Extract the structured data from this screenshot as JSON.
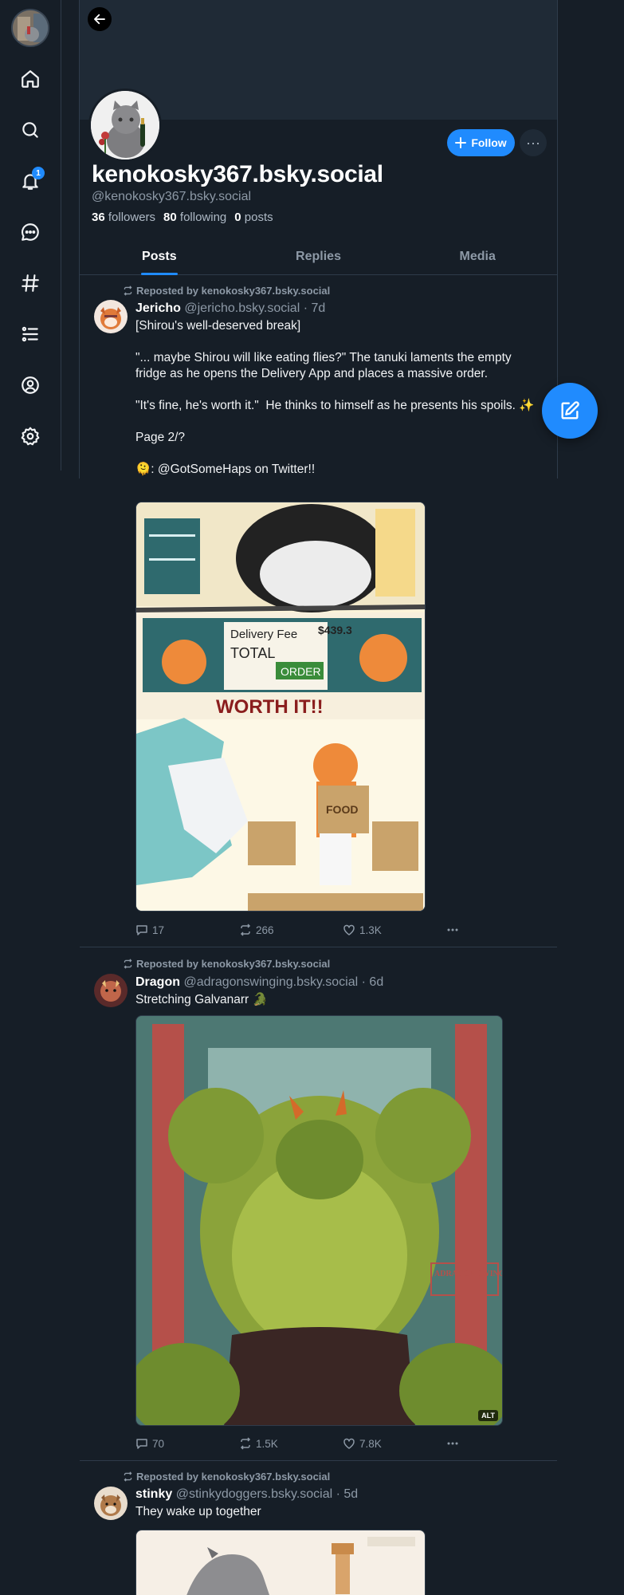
{
  "nav": {
    "notification_count": "1",
    "items": [
      "home-icon",
      "search-icon",
      "bell-icon",
      "chat-icon",
      "hashtag-icon",
      "list-icon",
      "profile-icon",
      "gear-icon"
    ]
  },
  "profile": {
    "display_name": "kenokosky367.bsky.social",
    "handle": "@kenokosky367.bsky.social",
    "followers_count": "36",
    "followers_label": "followers",
    "following_count": "80",
    "following_label": "following",
    "posts_count": "0",
    "posts_label": "posts",
    "follow_label": "Follow",
    "more_label": "···"
  },
  "tabs": [
    "Posts",
    "Replies",
    "Media"
  ],
  "posts": [
    {
      "repost_label": "Reposted by kenokosky367.bsky.social",
      "author": "Jericho",
      "handle": "@jericho.bsky.social",
      "time": "· 7d",
      "text": "[Shirou's well-deserved break]\n\n\"... maybe Shirou will like eating flies?\" The tanuki laments the empty fridge as he opens the Delivery App and places a massive order.\n\n\"It's fine, he's worth it.\"  He thinks to himself as he presents his spoils. ✨\n\nPage 2/?\n\n🫠: @GotSomeHaps on Twitter!!",
      "image_text_1": "Delivery Fee",
      "image_text_2": "TOTAL",
      "image_text_3": "$439.3",
      "image_text_4": "ORDER",
      "image_text_5": "WORTH IT!!",
      "image_text_6": "FOOD",
      "replies": "17",
      "reposts": "266",
      "likes": "1.3K"
    },
    {
      "repost_label": "Reposted by kenokosky367.bsky.social",
      "author": "Dragon",
      "handle": "@adragonswinging.bsky.social",
      "time": "· 6d",
      "text": "Stretching Galvanarr 🐊",
      "image_watermark": "ADRAGON SWINGING 2025",
      "alt": "ALT",
      "replies": "70",
      "reposts": "1.5K",
      "likes": "7.8K"
    },
    {
      "repost_label": "Reposted by kenokosky367.bsky.social",
      "author": "stinky",
      "handle": "@stinkydoggers.bsky.social",
      "time": "· 5d",
      "text": "They wake up together"
    }
  ],
  "colors": {
    "accent": "#208bfe",
    "background": "#161e27",
    "border": "#2e3b4a",
    "muted_text": "#8d99a6"
  }
}
